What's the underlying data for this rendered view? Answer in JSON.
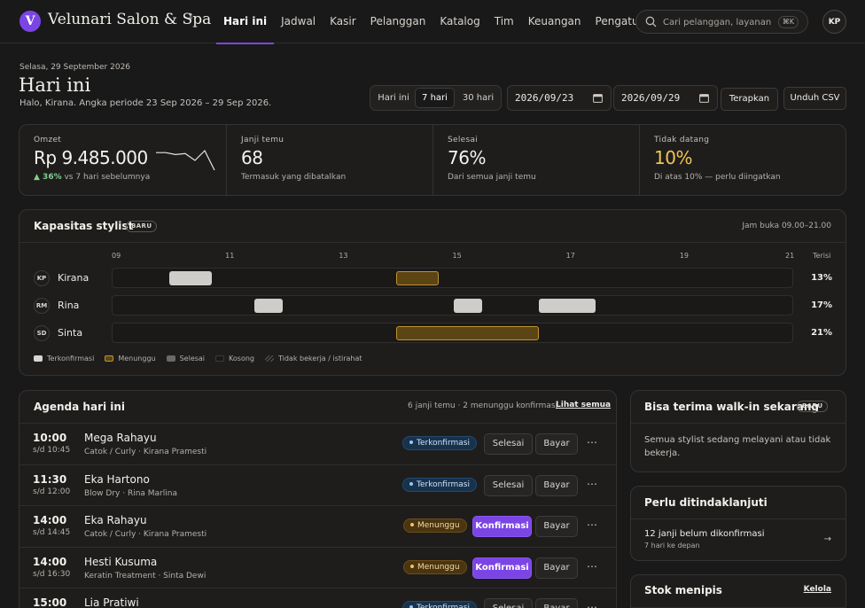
{
  "brand": {
    "logo_letter": "V",
    "name": "Velunari Salon & Spa",
    "switch_glyph": "⇕"
  },
  "nav": {
    "items": [
      "Hari ini",
      "Jadwal",
      "Kasir",
      "Pelanggan",
      "Katalog",
      "Tim",
      "Keuangan",
      "Pengaturan"
    ],
    "active_index": 0
  },
  "search": {
    "placeholder": "Cari pelanggan, layanan...",
    "shortcut": "⌘K"
  },
  "user": {
    "initials": "KP"
  },
  "header": {
    "date": "Selasa, 29 September 2026",
    "title": "Hari ini",
    "subtitle": "Halo, Kirana. Angka periode 23 Sep 2026 – 29 Sep 2026.",
    "range_options": [
      "Hari ini",
      "7 hari",
      "30 hari"
    ],
    "range_active": 1,
    "date_from": "2026/09/23",
    "date_to": "2026/09/29",
    "apply_label": "Terapkan",
    "download_label": "Unduh CSV"
  },
  "stats": {
    "revenue": {
      "label": "Omzet",
      "value": "Rp 9.485.000",
      "change": "▲ 36%",
      "change_note": "vs 7 hari sebelumnya",
      "sparkline": [
        6,
        6,
        5.8,
        5.9,
        5.2,
        6.2,
        4.2
      ]
    },
    "appointments": {
      "label": "Janji temu",
      "value": "68",
      "note": "Termasuk yang dibatalkan"
    },
    "completed": {
      "label": "Selesai",
      "value": "76%",
      "note": "Dari semua janji temu"
    },
    "no_show": {
      "label": "Tidak datang",
      "value": "10%",
      "note": "Di atas 10% — perlu diingatkan",
      "color": "#f1c452"
    }
  },
  "capacity": {
    "title": "Kapasitas stylist",
    "badge": "BARU",
    "hours_note": "Jam buka 09.00–21.00",
    "hour_ticks": [
      "09",
      "11",
      "13",
      "15",
      "17",
      "19",
      "21"
    ],
    "filled_label": "Terisi",
    "stylists": [
      {
        "initials": "KP",
        "name": "Kirana",
        "filled": "13%",
        "blocks": [
          {
            "start": 10,
            "end": 10.75,
            "status": "done"
          },
          {
            "start": 14,
            "end": 14.75,
            "status": "wait"
          }
        ]
      },
      {
        "initials": "RM",
        "name": "Rina",
        "filled": "17%",
        "blocks": [
          {
            "start": 11.5,
            "end": 12,
            "status": "done"
          },
          {
            "start": 15,
            "end": 15.5,
            "status": "done"
          },
          {
            "start": 16.5,
            "end": 17.5,
            "status": "done"
          }
        ]
      },
      {
        "initials": "SD",
        "name": "Sinta",
        "filled": "21%",
        "blocks": [
          {
            "start": 14,
            "end": 16.5,
            "status": "wait"
          }
        ]
      }
    ],
    "legend": [
      "Terkonfirmasi",
      "Menunggu",
      "Selesai",
      "Kosong",
      "Tidak bekerja / istirahat"
    ],
    "legend_colors": {
      "confirmed": "#d8d6d2",
      "waiting": "#c09233",
      "done": "#6b6966",
      "empty": "#1a1918"
    }
  },
  "agenda": {
    "title": "Agenda hari ini",
    "summary": "6 janji temu · 2 menunggu konfirmasi",
    "see_all": "Lihat semua",
    "rows": [
      {
        "time": "10:00",
        "end": "s/d 10:45",
        "name": "Mega Rahayu",
        "service": "Catok / Curly · Kirana Pramesti",
        "status": "Terkonfirmasi",
        "status_type": "ok",
        "action": "Selesai",
        "pay": "Bayar"
      },
      {
        "time": "11:30",
        "end": "s/d 12:00",
        "name": "Eka Hartono",
        "service": "Blow Dry · Rina Marlina",
        "status": "Terkonfirmasi",
        "status_type": "ok",
        "action": "Selesai",
        "pay": "Bayar"
      },
      {
        "time": "14:00",
        "end": "s/d 14:45",
        "name": "Eka Rahayu",
        "service": "Catok / Curly · Kirana Pramesti",
        "status": "Menunggu",
        "status_type": "wait",
        "action": "Konfirmasi",
        "pay": "Bayar"
      },
      {
        "time": "14:00",
        "end": "s/d 16:30",
        "name": "Hesti Kusuma",
        "service": "Keratin Treatment · Sinta Dewi",
        "status": "Menunggu",
        "status_type": "wait",
        "action": "Konfirmasi",
        "pay": "Bayar"
      },
      {
        "time": "15:00",
        "end": "",
        "name": "Lia Pratiwi",
        "service": "",
        "status": "Terkonfirmasi",
        "status_type": "ok",
        "action": "Selesai",
        "pay": "Bayar"
      }
    ],
    "more_glyph": "⋯"
  },
  "walkin": {
    "title": "Bisa terima walk-in sekarang",
    "badge": "BARU",
    "text": "Semua stylist sedang melayani atau tidak bekerja."
  },
  "followup": {
    "title": "Perlu ditindaklanjuti",
    "item_title": "12 janji belum dikonfirmasi",
    "item_sub": "7 hari ke depan",
    "arrow": "→"
  },
  "stock": {
    "title": "Stok menipis",
    "manage": "Kelola"
  }
}
